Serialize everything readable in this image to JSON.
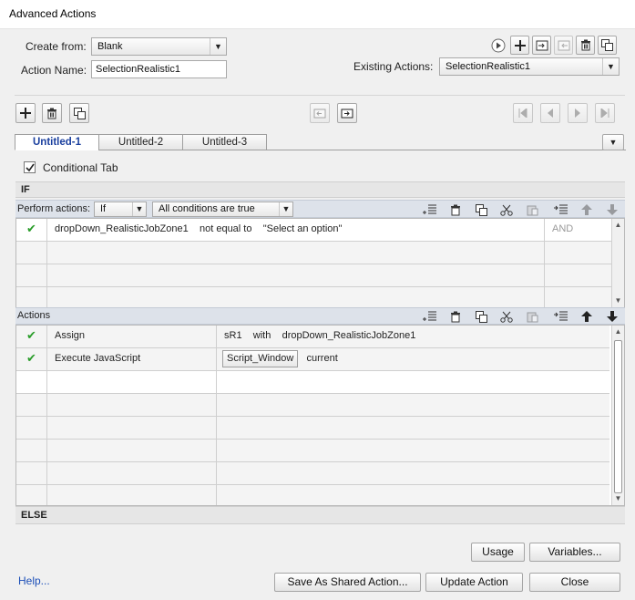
{
  "window": {
    "title": "Advanced Actions"
  },
  "form": {
    "create_from_label": "Create from:",
    "create_from_value": "Blank",
    "action_name_label": "Action Name:",
    "action_name_value": "SelectionRealistic1",
    "existing_actions_label": "Existing Actions:",
    "existing_actions_value": "SelectionRealistic1"
  },
  "tabs": [
    {
      "label": "Untitled-1",
      "active": true
    },
    {
      "label": "Untitled-2",
      "active": false
    },
    {
      "label": "Untitled-3",
      "active": false
    }
  ],
  "conditional_tab": {
    "label": "Conditional Tab",
    "checked": true
  },
  "if_section": {
    "header": "IF",
    "perform_actions_label": "Perform actions:",
    "perform_actions_value": "If",
    "conditions_value": "All conditions are true",
    "rows": [
      {
        "check": "✔",
        "variable": "dropDown_RealisticJobZone1",
        "operator": "not equal to",
        "value": "\"Select an option\"",
        "logic": "AND"
      }
    ]
  },
  "actions_section": {
    "header": "Actions",
    "rows": [
      {
        "check": "✔",
        "action": "Assign",
        "target": "sR1",
        "keyword": "with",
        "source": "dropDown_RealisticJobZone1"
      },
      {
        "check": "✔",
        "action": "Execute JavaScript",
        "script_button": "Script_Window",
        "window": "current"
      }
    ]
  },
  "else_section": {
    "header": "ELSE"
  },
  "buttons": {
    "usage": "Usage",
    "variables": "Variables...",
    "help": "Help...",
    "save_shared": "Save As Shared Action...",
    "update": "Update Action",
    "close": "Close"
  },
  "colors": {
    "check_green": "#2a9d2a",
    "active_tab_text": "#1a3f9e",
    "section_bar": "#dde2ea"
  }
}
